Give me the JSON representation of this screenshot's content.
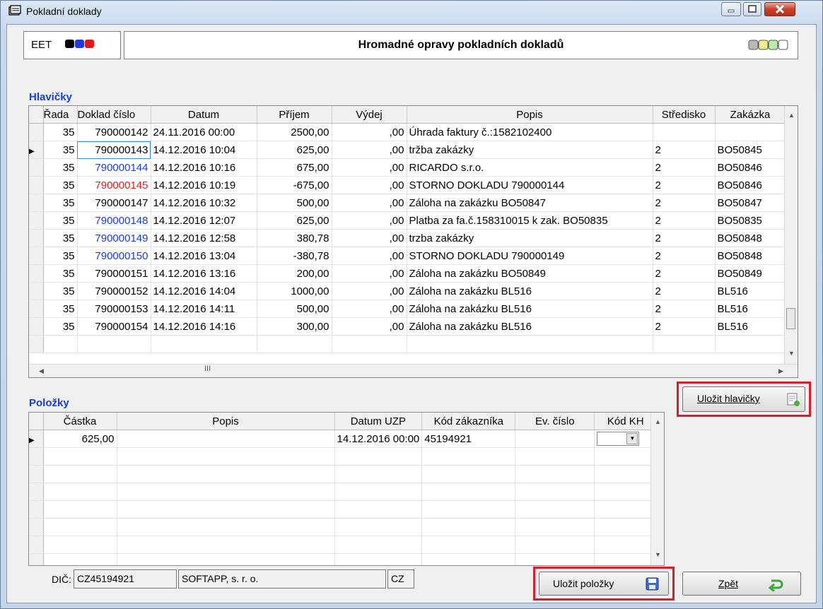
{
  "window": {
    "title": "Pokladní doklady"
  },
  "header": {
    "eet_label": "EET",
    "title": "Hromadné opravy pokladních dokladů"
  },
  "hlavicky": {
    "label": "Hlavičky",
    "columns": [
      "Řada",
      "Doklad číslo",
      "Datum",
      "Příjem",
      "Výdej",
      "Popis",
      "Středisko",
      "Zakázka"
    ],
    "rows": [
      {
        "rada": "35",
        "doklad": "790000142",
        "datum": "24.11.2016 00:00",
        "prijem": "2500,00",
        "vydej": ",00",
        "popis": "Úhrada faktury č.:1582102400",
        "stredisko": "",
        "zakazka": "",
        "color": "#000000"
      },
      {
        "rada": "35",
        "doklad": "790000143",
        "datum": "14.12.2016 10:04",
        "prijem": "625,00",
        "vydej": ",00",
        "popis": "tržba zakázky",
        "stredisko": "2",
        "zakazka": "BO50845",
        "color": "#000000"
      },
      {
        "rada": "35",
        "doklad": "790000144",
        "datum": "14.12.2016 10:16",
        "prijem": "675,00",
        "vydej": ",00",
        "popis": "RICARDO s.r.o.",
        "stredisko": "2",
        "zakazka": "BO50846",
        "color": "#1a3de0"
      },
      {
        "rada": "35",
        "doklad": "790000145",
        "datum": "14.12.2016 10:19",
        "prijem": "-675,00",
        "vydej": ",00",
        "popis": "STORNO DOKLADU 790000144",
        "stredisko": "2",
        "zakazka": "BO50846",
        "color": "#e02020"
      },
      {
        "rada": "35",
        "doklad": "790000147",
        "datum": "14.12.2016 10:32",
        "prijem": "500,00",
        "vydej": ",00",
        "popis": "Záloha na zakázku BO50847",
        "stredisko": "2",
        "zakazka": "BO50847",
        "color": "#000000"
      },
      {
        "rada": "35",
        "doklad": "790000148",
        "datum": "14.12.2016 12:07",
        "prijem": "625,00",
        "vydej": ",00",
        "popis": "Platba za fa.č.158310015 k zak. BO50835",
        "stredisko": "2",
        "zakazka": "BO50835",
        "color": "#1a3de0"
      },
      {
        "rada": "35",
        "doklad": "790000149",
        "datum": "14.12.2016 12:58",
        "prijem": "380,78",
        "vydej": ",00",
        "popis": "trzba zakázky",
        "stredisko": "2",
        "zakazka": "BO50848",
        "color": "#1a3de0"
      },
      {
        "rada": "35",
        "doklad": "790000150",
        "datum": "14.12.2016 13:04",
        "prijem": "-380,78",
        "vydej": ",00",
        "popis": "STORNO DOKLADU 790000149",
        "stredisko": "2",
        "zakazka": "BO50848",
        "color": "#1a3de0"
      },
      {
        "rada": "35",
        "doklad": "790000151",
        "datum": "14.12.2016 13:16",
        "prijem": "200,00",
        "vydej": ",00",
        "popis": "Záloha na zakázku BO50849",
        "stredisko": "2",
        "zakazka": "BO50849",
        "color": "#000000"
      },
      {
        "rada": "35",
        "doklad": "790000152",
        "datum": "14.12.2016 14:04",
        "prijem": "1000,00",
        "vydej": ",00",
        "popis": "Záloha na zakázku BL516",
        "stredisko": "2",
        "zakazka": "BL516",
        "color": "#000000"
      },
      {
        "rada": "35",
        "doklad": "790000153",
        "datum": "14.12.2016 14:11",
        "prijem": "500,00",
        "vydej": ",00",
        "popis": "Záloha na zakázku BL516",
        "stredisko": "2",
        "zakazka": "BL516",
        "color": "#000000"
      },
      {
        "rada": "35",
        "doklad": "790000154",
        "datum": "14.12.2016 14:16",
        "prijem": "300,00",
        "vydej": ",00",
        "popis": "Záloha na zakázku BL516",
        "stredisko": "2",
        "zakazka": "BL516",
        "color": "#000000"
      }
    ],
    "save_button": "Uložit hlavičky"
  },
  "polozky": {
    "label": "Položky",
    "columns": [
      "Částka",
      "Popis",
      "Datum UZP",
      "Kód zákazníka",
      "Ev. číslo",
      "Kód KH"
    ],
    "rows": [
      {
        "castka": "625,00",
        "popis": "",
        "datum": "14.12.2016 00:00",
        "kod": "45194921",
        "ev": "",
        "kh": ""
      }
    ],
    "save_button": "Uložit položky",
    "back_button": "Zpět"
  },
  "footer": {
    "dic_label": "DIČ:",
    "dic": "CZ45194921",
    "company": "SOFTAPP, s. r. o.",
    "country": "CZ"
  },
  "colors": {
    "accent_blue": "#1a3de0",
    "storno_red": "#e02020",
    "highlight_frame": "#d81e2c"
  }
}
